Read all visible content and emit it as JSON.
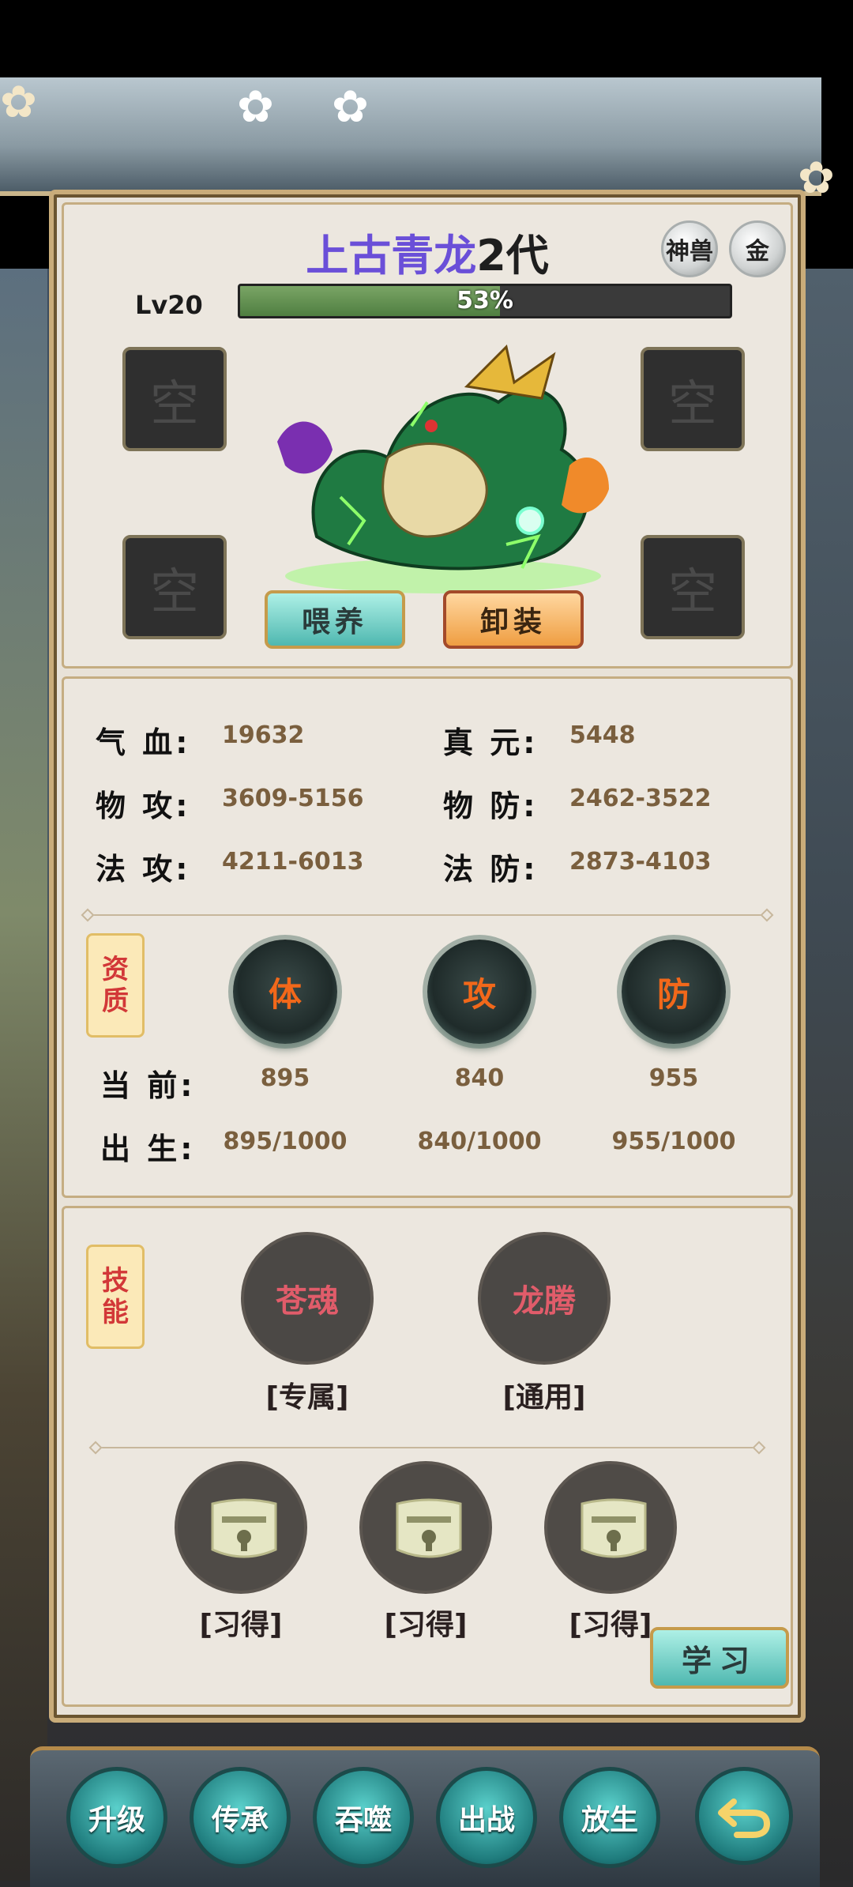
{
  "pet": {
    "name": "上古青龙",
    "generation": "2代",
    "badges": [
      "神兽",
      "金"
    ],
    "level": "Lv20",
    "exp_percent": 53,
    "exp_text": "53%",
    "slot_text": "空",
    "buttons": {
      "feed": "喂养",
      "unequip": "卸装"
    }
  },
  "stats": {
    "hp": {
      "label": "气 血:",
      "value": "19632"
    },
    "mp": {
      "label": "真 元:",
      "value": "5448"
    },
    "patk": {
      "label": "物 攻:",
      "value": "3609-5156"
    },
    "pdef": {
      "label": "物 防:",
      "value": "2462-3522"
    },
    "matk": {
      "label": "法 攻:",
      "value": "4211-6013"
    },
    "mdef": {
      "label": "法 防:",
      "value": "2873-4103"
    }
  },
  "aptitude": {
    "tag": [
      "资",
      "质"
    ],
    "orbs": [
      "体",
      "攻",
      "防"
    ],
    "current_label": "当 前:",
    "current": [
      "895",
      "840",
      "955"
    ],
    "birth_label": "出 生:",
    "birth": [
      "895/1000",
      "840/1000",
      "955/1000"
    ]
  },
  "skills": {
    "tag": [
      "技",
      "能"
    ],
    "items": [
      {
        "name": "苍魂",
        "type": "[专属]"
      },
      {
        "name": "龙腾",
        "type": "[通用]"
      }
    ],
    "locked_caption": "[习得]",
    "learn_button": "学习"
  },
  "bottom_nav": [
    "升级",
    "传承",
    "吞噬",
    "出战",
    "放生"
  ],
  "colors": {
    "name": "#6a4fd8",
    "value": "#7a5f3e",
    "skill": "#e15c6a",
    "orb_text": "#f2681a"
  }
}
